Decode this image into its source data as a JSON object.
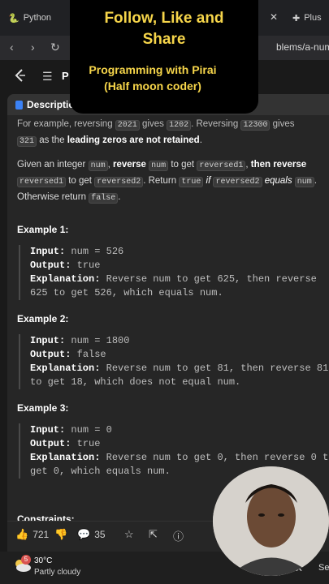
{
  "browser": {
    "tab_left": "Python",
    "tab_right": "Plus",
    "url": "blems/a-num"
  },
  "header": {
    "p_label": "P"
  },
  "panel": {
    "tab_label": "Description"
  },
  "problem": {
    "l1_pre": "For example, reversing ",
    "l1_code1": "2021",
    "l1_mid": " gives ",
    "l1_code2": "1202",
    "l1_mid2": ". Reversing ",
    "l1_code3": "12300",
    "l1_post": " gives",
    "l2_code": "321",
    "l2_pre": " as the ",
    "l2_bold": "leading zeros are not retained",
    "l2_post": ".",
    "p2_a": "Given an integer ",
    "p2_num": "num",
    "p2_b": ", ",
    "p2_reverse": "reverse",
    "p2_num2": "num",
    "p2_c": " to get ",
    "p2_rev1": "reversed1",
    "p2_d": ", ",
    "p2_then_reverse": "then reverse",
    "p2_rev1b": "reversed1",
    "p2_e": " to get ",
    "p2_rev2": "reversed2",
    "p2_f": ". Return ",
    "p2_true": "true",
    "p2_if": "if",
    "p2_rev2b": "reversed2",
    "p2_equals": "equals",
    "p2_num3": "num",
    "p2_g": ".",
    "p2_h": "Otherwise return ",
    "p2_false": "false",
    "p2_i": "."
  },
  "examples": [
    {
      "title": "Example 1:",
      "input_label": "Input:",
      "input_value": " num = 526",
      "output_label": "Output:",
      "output_value": " true",
      "expl_label": "Explanation:",
      "expl_l1": " Reverse num to get 625, then reverse",
      "expl_l2": "625 to get 526, which equals num."
    },
    {
      "title": "Example 2:",
      "input_label": "Input:",
      "input_value": " num = 1800",
      "output_label": "Output:",
      "output_value": " false",
      "expl_label": "Explanation:",
      "expl_l1": " Reverse num to get 81, then reverse 81",
      "expl_l2": "to get 18, which does not equal num."
    },
    {
      "title": "Example 3:",
      "input_label": "Input:",
      "input_value": " num = 0",
      "output_label": "Output:",
      "output_value": " true",
      "expl_label": "Explanation:",
      "expl_l1": " Reverse num to get 0, then reverse 0 to",
      "expl_l2": "get 0, which equals num."
    }
  ],
  "constraints_title": "Constraints:",
  "footer": {
    "likes": "721",
    "comments": "35"
  },
  "taskbar": {
    "badge": "5",
    "temp": "30°C",
    "condition": "Partly cloudy",
    "right_label": "Se"
  },
  "overlay": {
    "title_l1": "Follow, Like and",
    "title_l2": "Share",
    "sub_l1": "Programming with Pirai",
    "sub_l2": "(Half moon coder)",
    "color": "#f6d54a"
  },
  "icons": [
    "python-icon",
    "close-icon",
    "back-icon",
    "forward-icon",
    "reload-icon",
    "leetcode-logo-icon",
    "list-icon",
    "description-icon",
    "thumbs-up-icon",
    "thumbs-down-icon",
    "comment-icon",
    "star-icon",
    "share-icon",
    "help-icon",
    "weather-icon",
    "moon-icon"
  ]
}
